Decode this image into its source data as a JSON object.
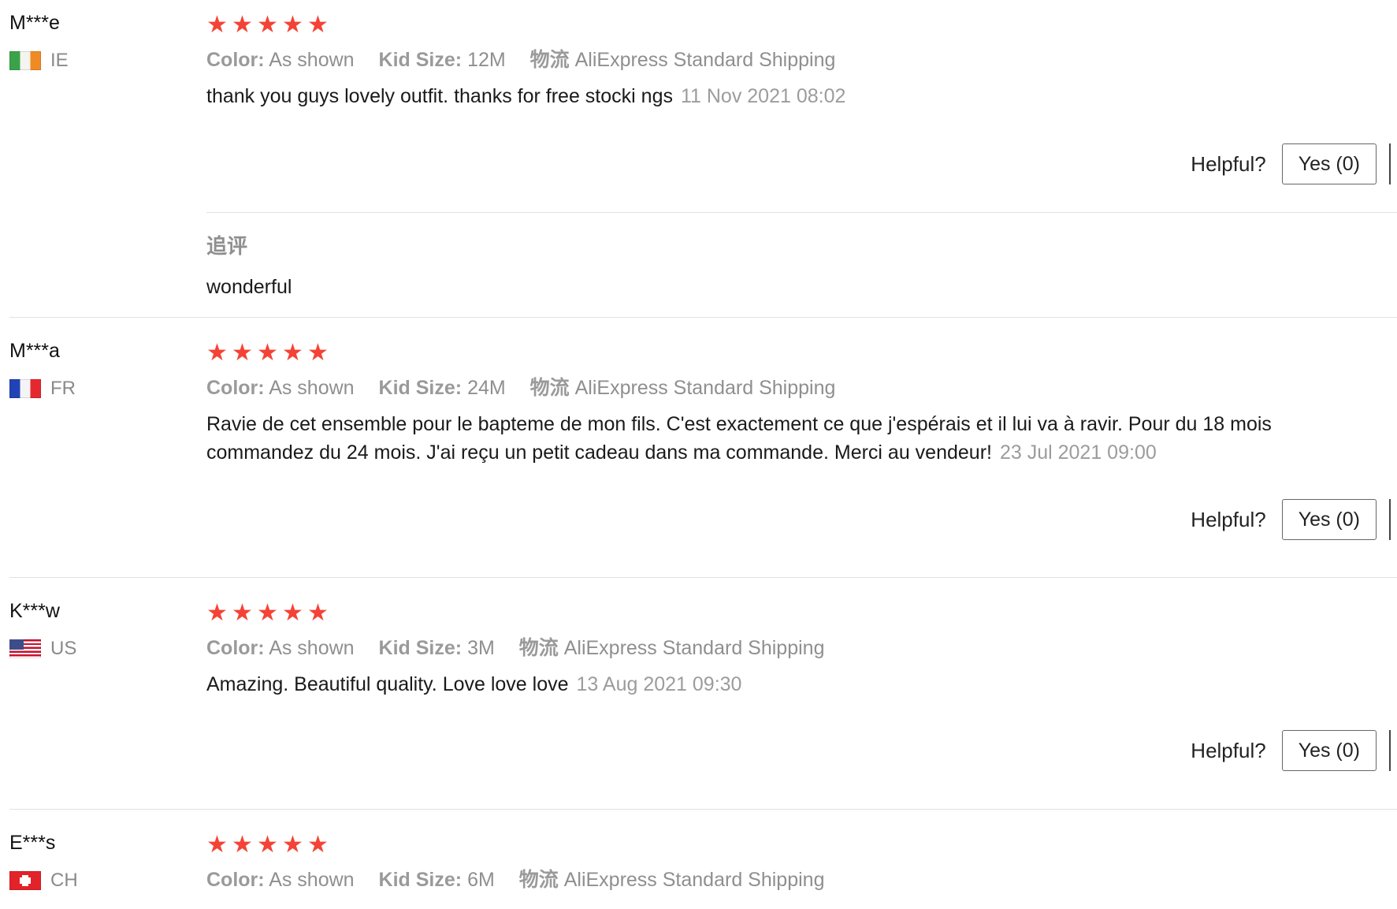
{
  "helpful_label": "Helpful?",
  "yes_label": "Yes (0)",
  "star_color": "#f44336",
  "reviews": [
    {
      "user": "M***e",
      "country": "IE",
      "flag": "ireland-flag",
      "rating": 5,
      "color_label": "Color:",
      "color_value": "As shown",
      "size_label": "Kid Size:",
      "size_value": "12M",
      "shipping_label": "物流",
      "shipping_value": "AliExpress Standard Shipping",
      "text": "thank you guys lovely outfit. thanks for free stocki ngs",
      "date": "11 Nov 2021 08:02",
      "followup_title": "追评",
      "followup_text": "wonderful"
    },
    {
      "user": "M***a",
      "country": "FR",
      "flag": "france-flag",
      "rating": 5,
      "color_label": "Color:",
      "color_value": "As shown",
      "size_label": "Kid Size:",
      "size_value": "24M",
      "shipping_label": "物流",
      "shipping_value": "AliExpress Standard Shipping",
      "text": "Ravie de cet ensemble pour le bapteme de mon fils. C'est exactement ce que j'espérais et il lui va à ravir. Pour du 18 mois commandez du 24 mois. J'ai reçu un petit cadeau dans ma commande. Merci au vendeur!",
      "date": "23 Jul 2021 09:00"
    },
    {
      "user": "K***w",
      "country": "US",
      "flag": "usa-flag",
      "rating": 5,
      "color_label": "Color:",
      "color_value": "As shown",
      "size_label": "Kid Size:",
      "size_value": "3M",
      "shipping_label": "物流",
      "shipping_value": "AliExpress Standard Shipping",
      "text": "Amazing. Beautiful quality. Love love love",
      "date": "13 Aug 2021 09:30"
    },
    {
      "user": "E***s",
      "country": "CH",
      "flag": "switzerland-flag",
      "rating": 5,
      "color_label": "Color:",
      "color_value": "As shown",
      "size_label": "Kid Size:",
      "size_value": "6M",
      "shipping_label": "物流",
      "shipping_value": "AliExpress Standard Shipping"
    }
  ]
}
